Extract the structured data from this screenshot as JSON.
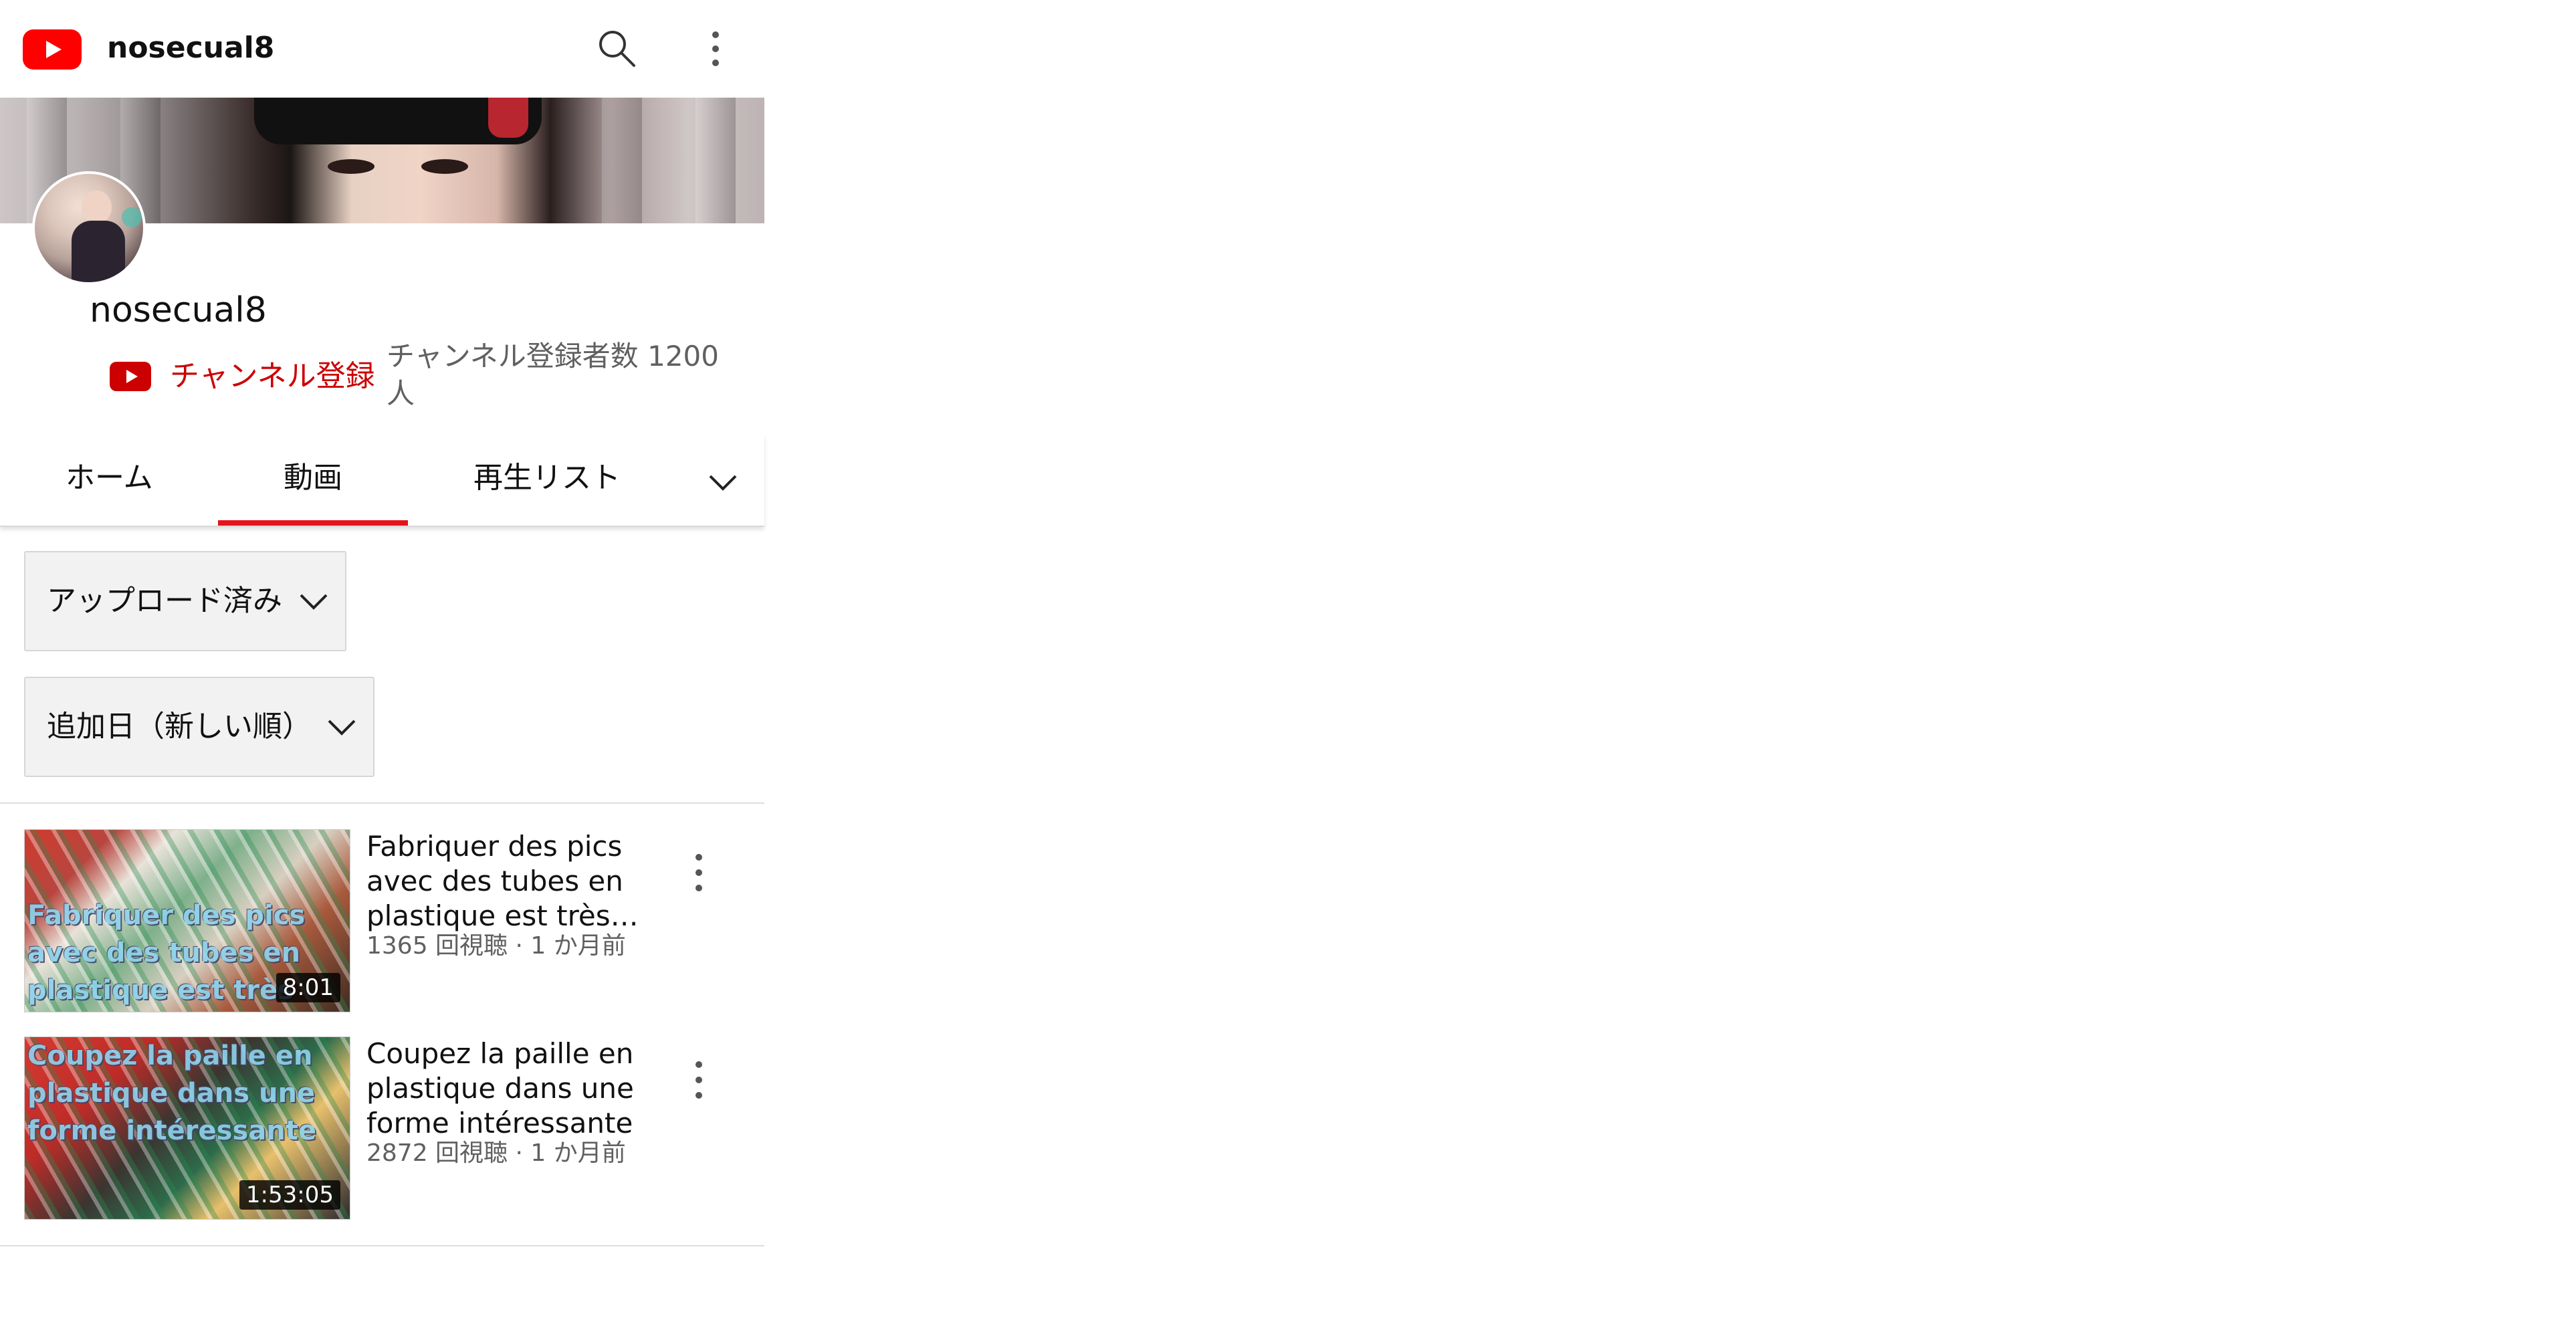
{
  "header": {
    "title": "nosecual8",
    "logo_icon": "youtube-logo-icon",
    "search_icon": "search-icon",
    "more_icon": "more-vert-icon"
  },
  "channel": {
    "name": "nosecual8",
    "subscribe_label": "チャンネル登録",
    "subscriber_count": "チャンネル登録者数 1200 人"
  },
  "tabs": [
    {
      "label": "ホーム"
    },
    {
      "label": "動画",
      "selected": true
    },
    {
      "label": "再生リスト"
    }
  ],
  "filters": {
    "content_type": "アップロード済み",
    "sort_order": "追加日（新しい順）"
  },
  "videos": [
    {
      "title": "Fabriquer des pics avec des tubes en plastique est très…",
      "thumbnail_text": "Fabriquer des pics avec des tubes en plastique est très difficile",
      "duration": "8:01",
      "meta": "1365 回視聴 · 1 か月前"
    },
    {
      "title": "Coupez la paille en plastique dans une forme intéressante",
      "thumbnail_text": "Coupez la paille en plastique dans une forme intéressante",
      "duration": "1:53:05",
      "meta": "2872 回視聴 · 1 か月前"
    }
  ],
  "colors": {
    "brand_red": "#ff0000",
    "subscribe_red": "#cc0000",
    "tab_underline": "#e4141b",
    "meta_gray": "#606060"
  }
}
